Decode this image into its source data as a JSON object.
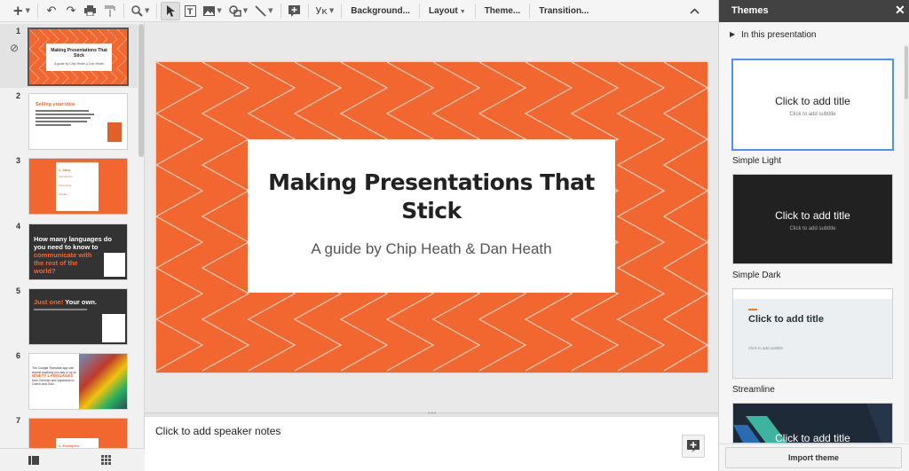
{
  "toolbar": {
    "language_label": "Ук",
    "background_label": "Background...",
    "layout_label": "Layout",
    "theme_label": "Theme...",
    "transition_label": "Transition..."
  },
  "filmstrip": {
    "slides": [
      {
        "number": "1",
        "title": "Making Presentations That Stick",
        "subtitle": "A guide by Chip Heath & Dan Heath"
      },
      {
        "number": "2",
        "title": "Selling your idea"
      },
      {
        "number": "3",
        "title": "1. Intro",
        "items": [
          "Introduction",
          "Presenting",
          "Visuals"
        ]
      },
      {
        "number": "4",
        "title": "How many languages do you need to know to",
        "highlight": "communicate with the rest of the world?"
      },
      {
        "number": "5",
        "highlight": "Just one!",
        "title": "Your own."
      },
      {
        "number": "6",
        "text": "The Google Translate app can repeat anything you say in up to",
        "highlight": "NINETY LANGUAGES",
        "tail": "from German and Japanese to Czech and Zulu"
      },
      {
        "number": "7",
        "title": "2. Examples"
      }
    ]
  },
  "slide": {
    "title": "Making Presentations That Stick",
    "subtitle": "A guide by Chip Heath & Dan Heath"
  },
  "notes": {
    "placeholder": "Click to add speaker notes"
  },
  "themes_panel": {
    "title": "Themes",
    "section_label": "In this presentation",
    "themes": [
      {
        "name": "Simple Light",
        "card_title": "Click to add title",
        "card_subtitle": "Click to add subtitle",
        "bg": "#ffffff",
        "text_color": "#222222"
      },
      {
        "name": "Simple Dark",
        "card_title": "Click to add title",
        "card_subtitle": "Click to add subtitle",
        "bg": "#212121",
        "text_color": "#ffffff"
      },
      {
        "name": "Streamline",
        "card_title": "Click to add title",
        "card_subtitle": "Click to add subtitle",
        "bg": "#eceff1",
        "text_color": "#263238"
      },
      {
        "name": "",
        "card_title": "Click to add title",
        "bg": "#1e2a38",
        "text_color": "#ffffff"
      }
    ],
    "import_label": "Import theme"
  },
  "colors": {
    "accent_orange": "#f26630",
    "panel_header": "#424242",
    "selection_blue": "#4d90fe"
  }
}
